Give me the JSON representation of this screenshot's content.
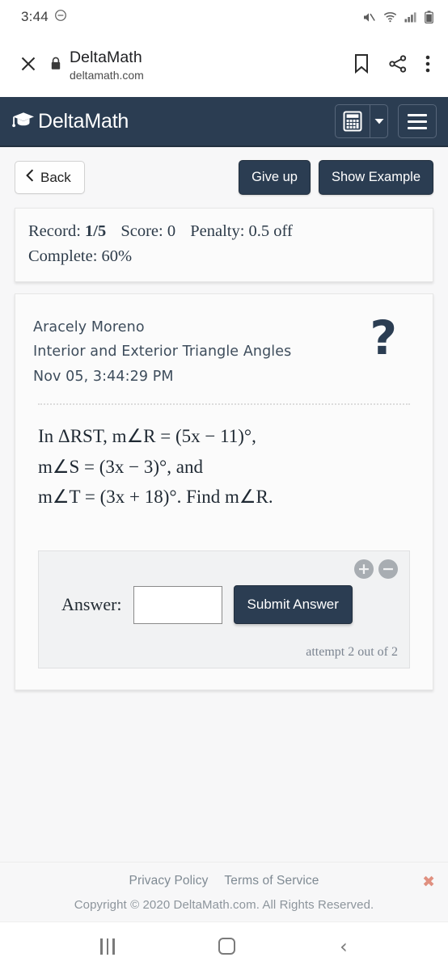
{
  "status_bar": {
    "time": "3:44",
    "dnd_icon": "do-not-disturb-icon",
    "mute_icon": "volume-muted-icon",
    "wifi_icon": "wifi-icon",
    "signal_icon": "cell-signal-icon",
    "battery_icon": "battery-icon"
  },
  "browser_bar": {
    "close_icon": "close-icon",
    "lock_icon": "lock-icon",
    "title": "DeltaMath",
    "host": "deltamath.com",
    "bookmark_icon": "bookmark-icon",
    "share_icon": "share-icon",
    "overflow_icon": "more-vertical-icon"
  },
  "app_header": {
    "brand": "DeltaMath",
    "logo_icon": "graduation-cap-icon",
    "calculator_icon": "calculator-icon",
    "caret_icon": "chevron-down-icon",
    "menu_icon": "hamburger-menu-icon",
    "bg_color": "#2b3d52"
  },
  "toolbar": {
    "back_label": "Back",
    "back_icon": "chevron-left-icon",
    "give_up_label": "Give up",
    "show_example_label": "Show Example"
  },
  "record": {
    "record_label": "Record:",
    "record_value": "1/5",
    "score_label": "Score:",
    "score_value": "0",
    "penalty_label": "Penalty:",
    "penalty_value": "0.5 off",
    "complete_label": "Complete:",
    "complete_value": "60%"
  },
  "problem": {
    "student_name": "Aracely Moreno",
    "assignment_title": "Interior and Exterior Triangle Angles",
    "timestamp": "Nov 05, 3:44:29 PM",
    "help_icon": "question-mark-icon",
    "statement_lines": [
      "In ΔRST, m∠R = (5x − 11)°,",
      "m∠S = (3x − 3)°, and",
      "m∠T = (3x + 18)°. Find m∠R."
    ],
    "statement_plain": "In ΔRST, m∠R = (5x − 11)°, m∠S = (3x − 3)°, and m∠T = (3x + 18)°. Find m∠R."
  },
  "answer_area": {
    "zoom_in_label": "+",
    "zoom_out_label": "−",
    "zoom_in_icon": "font-increase-icon",
    "zoom_out_icon": "font-decrease-icon",
    "answer_label": "Answer:",
    "answer_value": "",
    "answer_placeholder": "",
    "submit_label": "Submit Answer",
    "attempt_text": "attempt 2 out of 2"
  },
  "footer": {
    "privacy_label": "Privacy Policy",
    "terms_label": "Terms of Service",
    "copyright": "Copyright © 2020 DeltaMath.com. All Rights Reserved.",
    "close_icon": "close-x-icon",
    "close_color": "#e09080"
  },
  "nav_bar": {
    "recent_icon": "recent-apps-icon",
    "home_icon": "home-icon",
    "back_icon": "back-icon"
  }
}
